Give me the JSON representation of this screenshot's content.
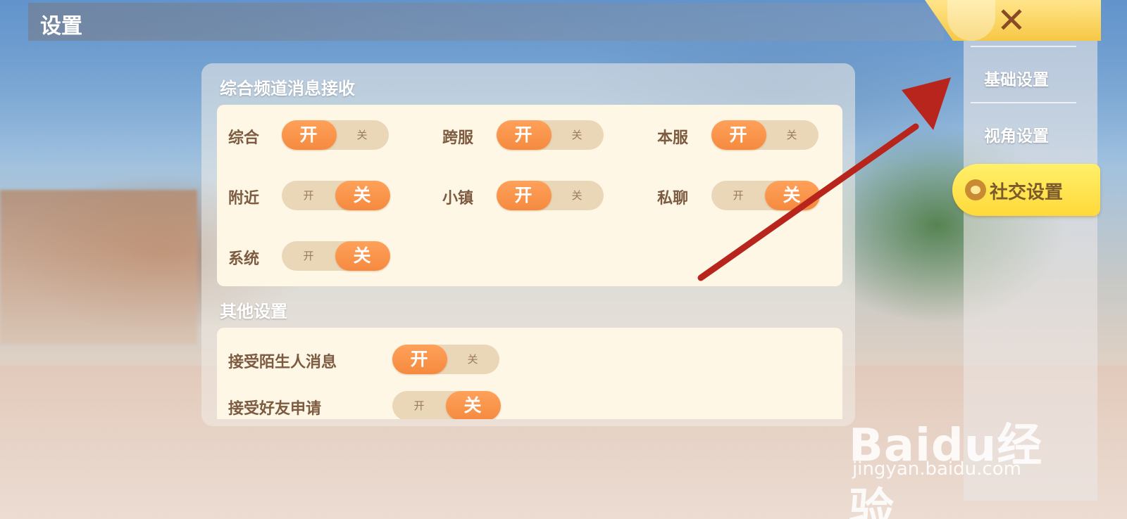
{
  "header": {
    "title": "设置"
  },
  "sections": [
    {
      "title": "综合频道消息接收",
      "toggles": [
        {
          "label": "综合",
          "state": "on"
        },
        {
          "label": "跨服",
          "state": "on"
        },
        {
          "label": "本服",
          "state": "on"
        },
        {
          "label": "附近",
          "state": "off"
        },
        {
          "label": "小镇",
          "state": "on"
        },
        {
          "label": "私聊",
          "state": "off"
        },
        {
          "label": "系统",
          "state": "off"
        }
      ]
    },
    {
      "title": "其他设置",
      "toggles": [
        {
          "label": "接受陌生人消息",
          "state": "on"
        },
        {
          "label": "接受好友申请",
          "state": "off"
        }
      ]
    }
  ],
  "toggle_text": {
    "on": "开",
    "off": "关"
  },
  "sidebar": {
    "items": [
      {
        "label": "基础设置"
      },
      {
        "label": "视角设置"
      },
      {
        "label": "社交设置",
        "active": true
      }
    ]
  },
  "close_icon": "close-x-icon",
  "watermark": {
    "brand": "Baidu经验",
    "site": "jingyan.baidu.com"
  },
  "colors": {
    "accent": "#f58a3f",
    "toggle_track": "#ead7b8",
    "card_bg": "#fef7e6",
    "label": "#7d5b41",
    "active_tab": "#ffd93a",
    "annotation_arrow": "#b8251c"
  }
}
